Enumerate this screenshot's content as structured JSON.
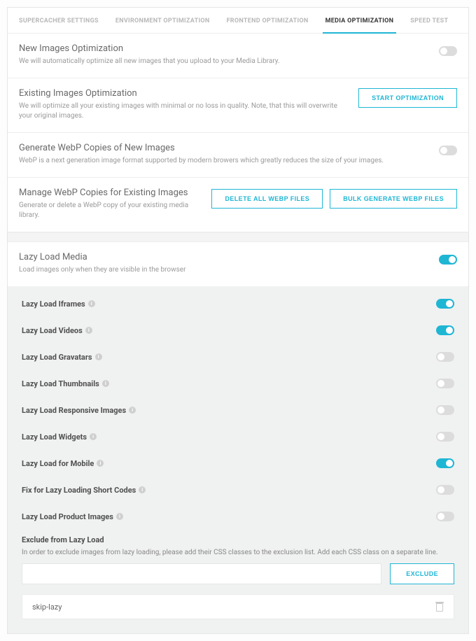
{
  "tabs": [
    {
      "label": "SUPERCACHER SETTINGS",
      "active": false
    },
    {
      "label": "ENVIRONMENT OPTIMIZATION",
      "active": false
    },
    {
      "label": "FRONTEND OPTIMIZATION",
      "active": false
    },
    {
      "label": "MEDIA OPTIMIZATION",
      "active": true
    },
    {
      "label": "SPEED TEST",
      "active": false
    }
  ],
  "new_images": {
    "title": "New Images Optimization",
    "desc": "We will automatically optimize all new images that you upload to your Media Library.",
    "enabled": false
  },
  "existing_images": {
    "title": "Existing Images Optimization",
    "desc": "We will optimize all your existing images with minimal or no loss in quality. Note, that this will overwrite your original images.",
    "button": "START OPTIMIZATION"
  },
  "gen_webp": {
    "title": "Generate WebP Copies of New Images",
    "desc": "WebP is a next generation image format supported by modern browers which greatly reduces the size of your images.",
    "enabled": false
  },
  "manage_webp": {
    "title": "Manage WebP Copies for Existing Images",
    "desc": "Generate or delete a WebP copy of your existing media library.",
    "delete_btn": "DELETE ALL WEBP FILES",
    "bulk_btn": "BULK GENERATE WEBP FILES"
  },
  "lazy": {
    "title": "Lazy Load Media",
    "desc": "Load images only when they are visible in the browser",
    "enabled": true,
    "options": [
      {
        "label": "Lazy Load Iframes",
        "info": true,
        "on": true
      },
      {
        "label": "Lazy Load Videos",
        "info": true,
        "on": true
      },
      {
        "label": "Lazy Load Gravatars",
        "info": true,
        "on": false
      },
      {
        "label": "Lazy Load Thumbnails",
        "info": true,
        "on": false
      },
      {
        "label": "Lazy Load Responsive Images",
        "info": true,
        "on": false
      },
      {
        "label": "Lazy Load Widgets",
        "info": true,
        "on": false
      },
      {
        "label": "Lazy Load for Mobile",
        "info": true,
        "on": true
      },
      {
        "label": "Fix for Lazy Loading Short Codes",
        "info": true,
        "on": false
      },
      {
        "label": "Lazy Load Product Images",
        "info": true,
        "on": false
      }
    ],
    "exclude": {
      "title": "Exclude from Lazy Load",
      "desc": "In order to exclude images from lazy loading, please add their CSS classes to the exclusion list. Add each CSS class on a separate line.",
      "button": "EXCLUDE",
      "items": [
        "skip-lazy"
      ]
    }
  }
}
